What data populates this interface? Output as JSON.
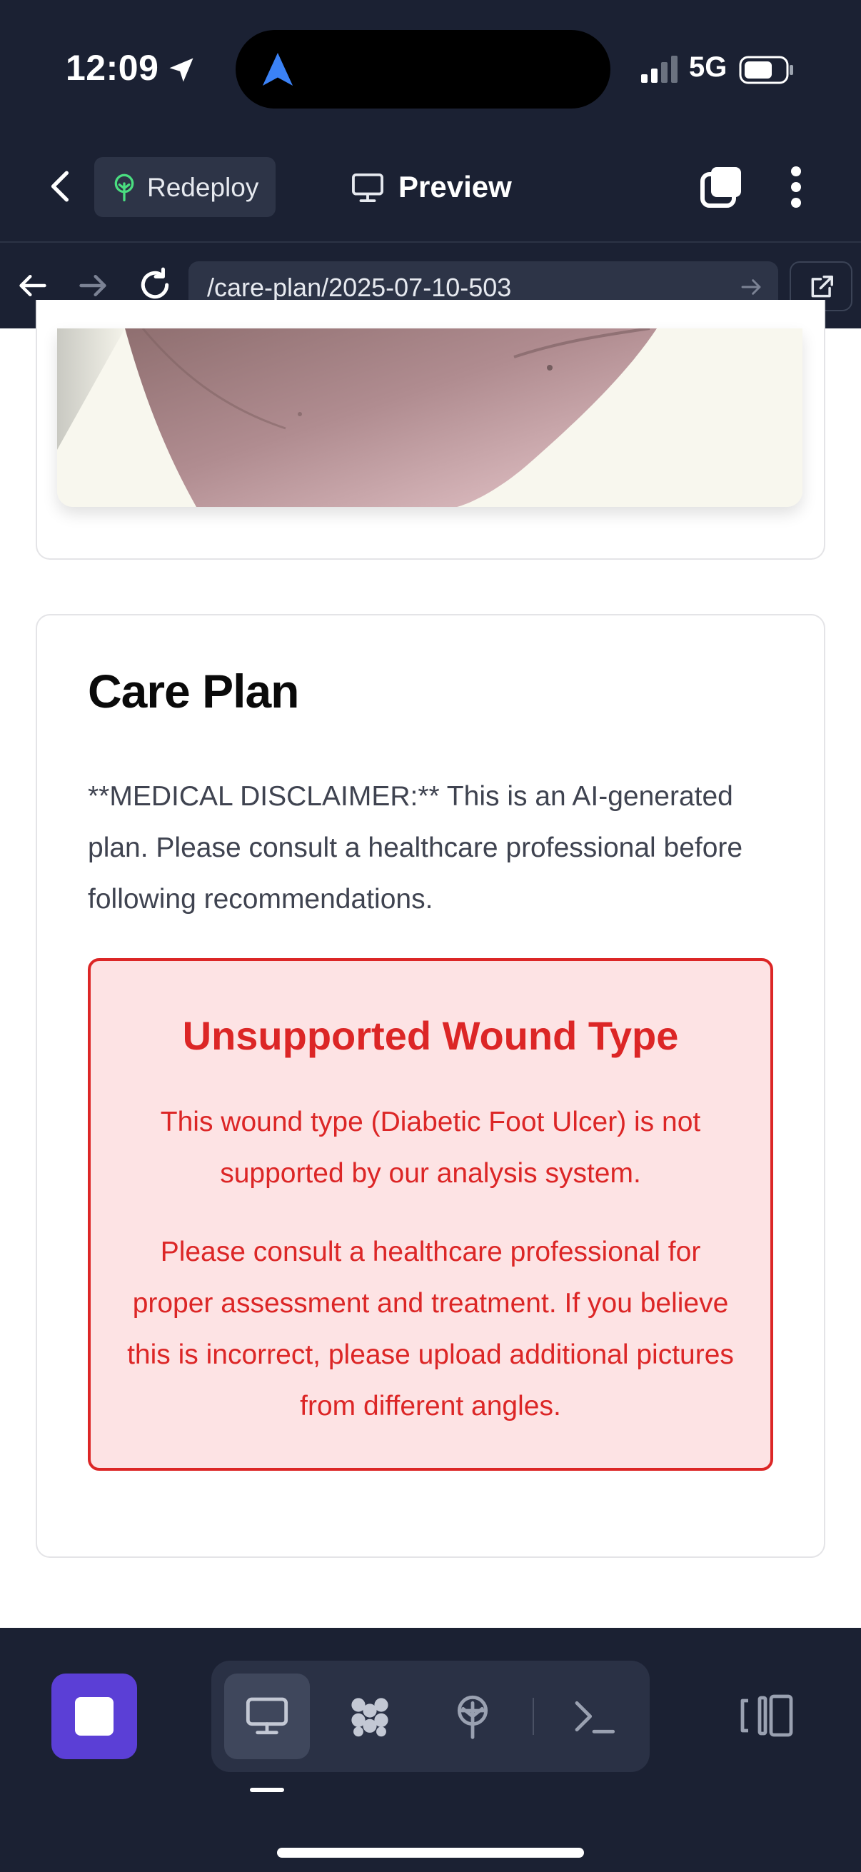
{
  "status_bar": {
    "time": "12:09",
    "network": "5G"
  },
  "header": {
    "redeploy_label": "Redeploy",
    "preview_label": "Preview"
  },
  "address_bar": {
    "url": "/care-plan/2025-07-10-503"
  },
  "care_plan": {
    "title": "Care Plan",
    "disclaimer": "**MEDICAL DISCLAIMER:** This is an AI-generated plan. Please consult a healthcare professional before following recommendations.",
    "alert": {
      "title": "Unsupported Wound Type",
      "message_1": "This wound type (Diabetic Foot Ulcer) is not supported by our analysis system.",
      "message_2": "Please consult a healthcare professional for proper assessment and treatment. If you believe this is incorrect, please upload additional pictures from different angles."
    }
  },
  "bottom_toolbar": {
    "tools": [
      "desktop-preview",
      "workspace",
      "deployment",
      "terminal"
    ],
    "active_tool": "desktop-preview"
  },
  "colors": {
    "chrome_bg": "#1b2133",
    "accent_purple": "#5b3fd6",
    "alert_red": "#dc2626",
    "alert_bg": "#fde3e4",
    "redeploy_green": "#4ade80",
    "island_blue": "#3b82f6"
  }
}
